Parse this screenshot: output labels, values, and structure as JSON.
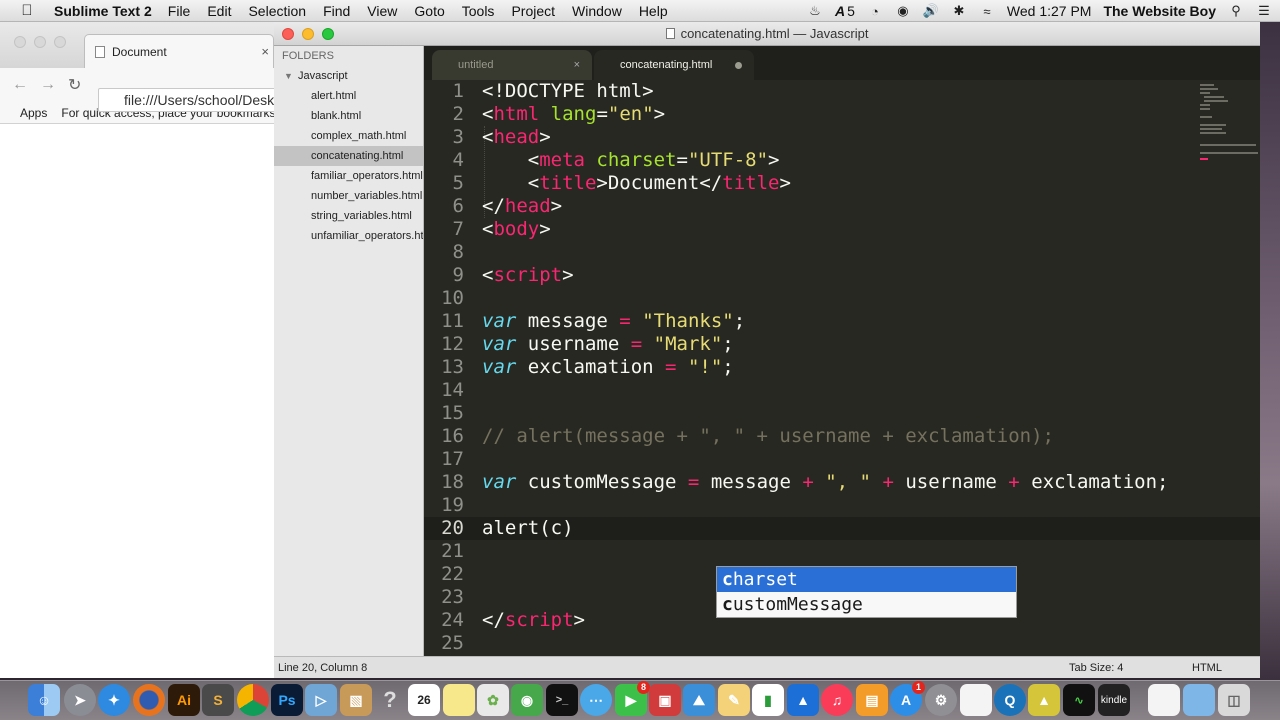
{
  "menubar": {
    "apple": "",
    "app_name": "Sublime Text 2",
    "menus": [
      "File",
      "Edit",
      "Selection",
      "Find",
      "View",
      "Goto",
      "Tools",
      "Project",
      "Window",
      "Help"
    ],
    "adobe_badge": "5",
    "clock": "Wed 1:27 PM",
    "user": "The Website Boy"
  },
  "chrome": {
    "tab_title": "Document",
    "url": "file:///Users/school/Desktop/Javascript/concatenating.html",
    "bookmarks_apps": "Apps",
    "bookmarks_hint": "For quick access, place your bookmarks here on the bookmarks bar."
  },
  "sublime": {
    "window_title": "concatenating.html — Javascript",
    "sidebar": {
      "header": "FOLDERS",
      "folder": "Javascript",
      "files": [
        "alert.html",
        "blank.html",
        "complex_math.html",
        "concatenating.html",
        "familiar_operators.html",
        "number_variables.html",
        "string_variables.html",
        "unfamiliar_operators.html"
      ],
      "active_file": "concatenating.html"
    },
    "tabs": [
      {
        "label": "untitled",
        "close": "×"
      },
      {
        "label": "concatenating.html"
      }
    ],
    "line_numbers": [
      "1",
      "2",
      "3",
      "4",
      "5",
      "6",
      "7",
      "8",
      "9",
      "10",
      "11",
      "12",
      "13",
      "14",
      "15",
      "16",
      "17",
      "18",
      "19",
      "20",
      "21",
      "22",
      "23",
      "24",
      "25"
    ],
    "autocomplete": [
      {
        "match": "c",
        "rest": "harset"
      },
      {
        "match": "c",
        "rest": "ustomMessage"
      }
    ],
    "status": {
      "position": "Line 20, Column 8",
      "tab_size": "Tab Size: 4",
      "syntax": "HTML"
    }
  },
  "dock": {
    "badges": {
      "calendar_day": "26",
      "facetime": "8",
      "appstore": "1"
    },
    "kindle_label": "kindle"
  }
}
